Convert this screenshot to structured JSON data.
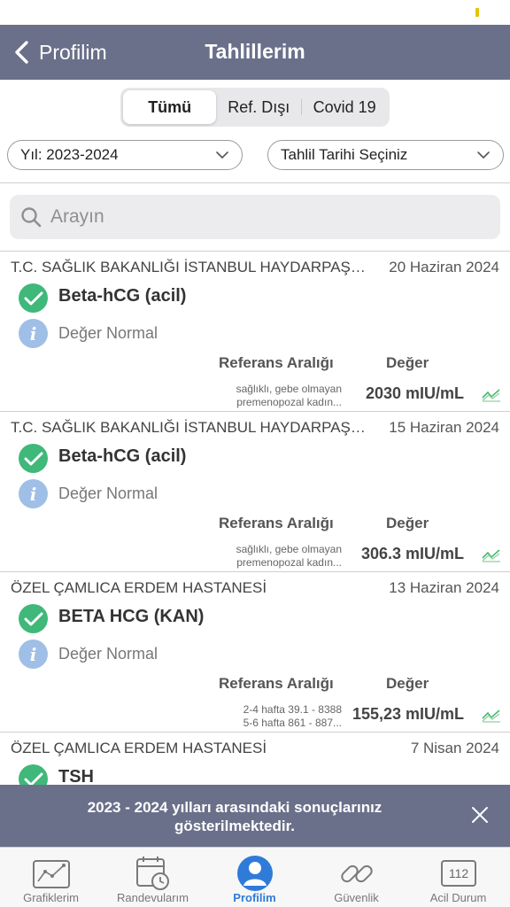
{
  "nav": {
    "back_label": "Profilim",
    "title": "Tahlillerim"
  },
  "filters": {
    "segments": [
      "Tümü",
      "Ref. Dışı",
      "Covid 19"
    ],
    "active_segment": "Tümü",
    "year": "Yıl: 2023-2024",
    "date": "Tahlil Tarihi Seçiniz"
  },
  "search": {
    "placeholder": "Arayın"
  },
  "results": [
    {
      "hospital": "T.C. SAĞLIK BAKANLIĞI İSTANBUL HAYDARPAŞA NUMUNE EĞİTİM VE ARAŞTIRMA HASTANESİ",
      "date": "20 Haziran 2024",
      "test": "Beta-hCG (acil)",
      "status": "Değer Normal",
      "ref_header": "Referans Aralığı",
      "value_header": "Değer",
      "ref_lines": [
        "sağlıklı, gebe olmayan",
        "premenopozal kadın..."
      ],
      "value": "2030 mIU/mL"
    },
    {
      "hospital": "T.C. SAĞLIK BAKANLIĞI İSTANBUL HAYDARPAŞA NUMUNE EĞİTİM VE ARAŞTIRMA HASTANESİ",
      "date": "15 Haziran 2024",
      "test": "Beta-hCG (acil)",
      "status": "Değer Normal",
      "ref_header": "Referans Aralığı",
      "value_header": "Değer",
      "ref_lines": [
        "sağlıklı, gebe olmayan",
        "premenopozal kadın..."
      ],
      "value": "306.3 mIU/mL"
    },
    {
      "hospital": "ÖZEL ÇAMLICA ERDEM HASTANESİ",
      "date": "13 Haziran 2024",
      "test": "BETA HCG (KAN)",
      "status": "Değer Normal",
      "ref_header": "Referans Aralığı",
      "value_header": "Değer",
      "ref_lines": [
        "2-4 hafta 39.1 - 8388",
        "5-6 hafta 861 - 887..."
      ],
      "value": "155,23 mIU/mL"
    },
    {
      "hospital": "ÖZEL ÇAMLICA ERDEM HASTANESİ",
      "date": "7 Nisan 2024",
      "test": "TSH"
    }
  ],
  "toast": {
    "line1": "2023 - 2024 yılları arasındaki sonuçlarınız",
    "line2": "gösterilmektedir."
  },
  "tabs": [
    {
      "label": "Grafiklerim",
      "icon": "chart-icon"
    },
    {
      "label": "Randevularım",
      "icon": "calendar-clock-icon"
    },
    {
      "label": "Profilim",
      "icon": "profile-icon",
      "active": true
    },
    {
      "label": "Güvenlik",
      "icon": "link-icon"
    },
    {
      "label": "Acil Durum",
      "icon": "emergency-112-icon",
      "badge": "112"
    }
  ],
  "colors": {
    "nav_bg": "#6a708a",
    "check_green": "#3fb87a",
    "info_blue": "#9fbfe6",
    "active_tab": "#2f7bd8"
  }
}
